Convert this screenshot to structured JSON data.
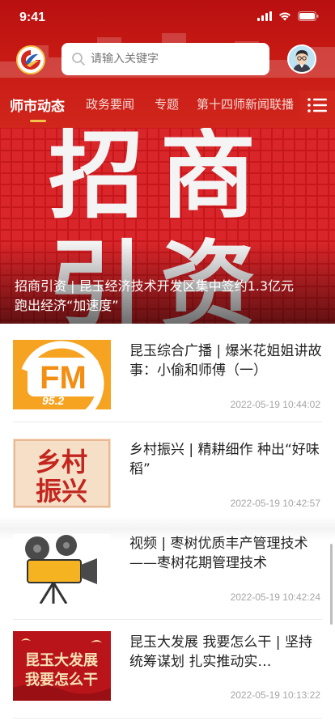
{
  "status_bar": {
    "time": "9:41"
  },
  "search": {
    "placeholder": "请输入关键字"
  },
  "tabs": [
    {
      "label": "师市动态",
      "active": true
    },
    {
      "label": "政务要闻",
      "active": false
    },
    {
      "label": "专题",
      "active": false
    },
    {
      "label": "第十四师新闻联播",
      "active": false
    }
  ],
  "hero": {
    "image_text": "招商引资",
    "title": "招商引资 | 昆玉经济技术开发区集中签约1.3亿元 跑出经济“加速度”"
  },
  "articles": [
    {
      "title": "昆玉综合广播 | 爆米花姐姐讲故事：小偷和师傅（一）",
      "time": "2022-05-19 10:44:02",
      "thumb_text": "FM",
      "thumb_sub": "95.2"
    },
    {
      "title": "乡村振兴 | 精耕细作 种出“好味稻”",
      "time": "2022-05-19 10:42:57",
      "thumb_text": "乡村振兴"
    },
    {
      "title": "视频 | 枣树优质丰产管理技术——枣树花期管理技术",
      "time": "2022-05-19 10:42:24",
      "thumb_text": ""
    },
    {
      "title": "昆玉大发展 我要怎么干 | 坚持统筹谋划 扎实推动实…",
      "time": "2022-05-19 10:13:22",
      "thumb_text": "昆玉大发展 我要怎么干"
    }
  ],
  "colors": {
    "brand_red": "#c81a14",
    "accent_gold": "#f3c24a"
  }
}
